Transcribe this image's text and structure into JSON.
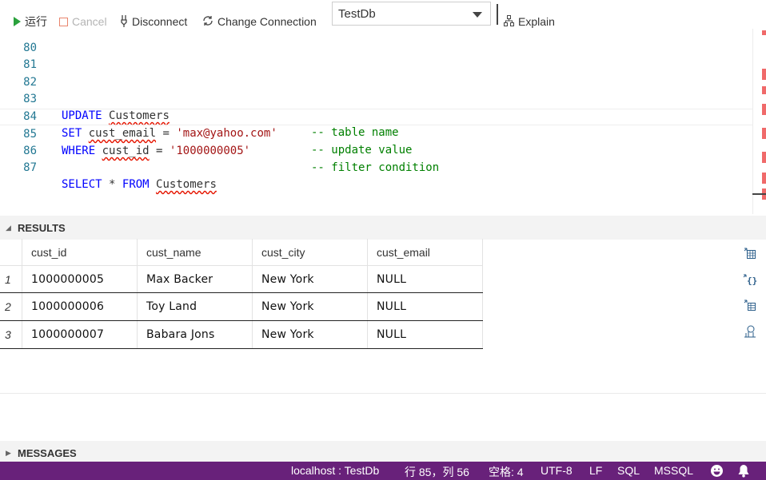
{
  "toolbar": {
    "run_label": "运行",
    "cancel_label": "Cancel",
    "disconnect_label": "Disconnect",
    "change_connection_label": "Change Connection",
    "database_selected": "TestDb",
    "explain_label": "Explain"
  },
  "editor": {
    "lines": [
      {
        "number": "80"
      },
      {
        "number": "81"
      },
      {
        "number": "82"
      },
      {
        "number": "83",
        "kw1": "UPDATE",
        "ident": "Customers",
        "comment": "-- table name"
      },
      {
        "number": "84",
        "kw1": "SET",
        "ident": "cust_email",
        "op": "=",
        "str": "'max@yahoo.com'",
        "comment": "-- update value"
      },
      {
        "number": "85",
        "kw1": "WHERE",
        "ident": "cust_id",
        "op": "=",
        "str": "'1000000005'",
        "comment": "-- filter condition"
      },
      {
        "number": "86"
      },
      {
        "number": "87",
        "kw1": "SELECT",
        "star": "*",
        "kw2": "FROM",
        "ident": "Customers"
      }
    ]
  },
  "results": {
    "title": "RESULTS",
    "columns": [
      "cust_id",
      "cust_name",
      "cust_city",
      "cust_email"
    ],
    "rows": [
      {
        "index": "1",
        "cells": [
          "1000000005",
          "Max Backer",
          "New York",
          "NULL"
        ]
      },
      {
        "index": "2",
        "cells": [
          "1000000006",
          "Toy Land",
          "New York",
          "NULL"
        ]
      },
      {
        "index": "3",
        "cells": [
          "1000000007",
          "Babara Jons",
          "New York",
          "NULL"
        ]
      }
    ],
    "side_icons": [
      "export-csv-icon",
      "export-json-icon",
      "export-excel-icon",
      "chart-icon"
    ]
  },
  "messages": {
    "title": "MESSAGES"
  },
  "status_bar": {
    "connection": "localhost : TestDb",
    "position": "行 85，列 56",
    "indent": "空格: 4",
    "encoding": "UTF-8",
    "eol": "LF",
    "language": "SQL",
    "dialect": "MSSQL",
    "color": "#68217a"
  }
}
